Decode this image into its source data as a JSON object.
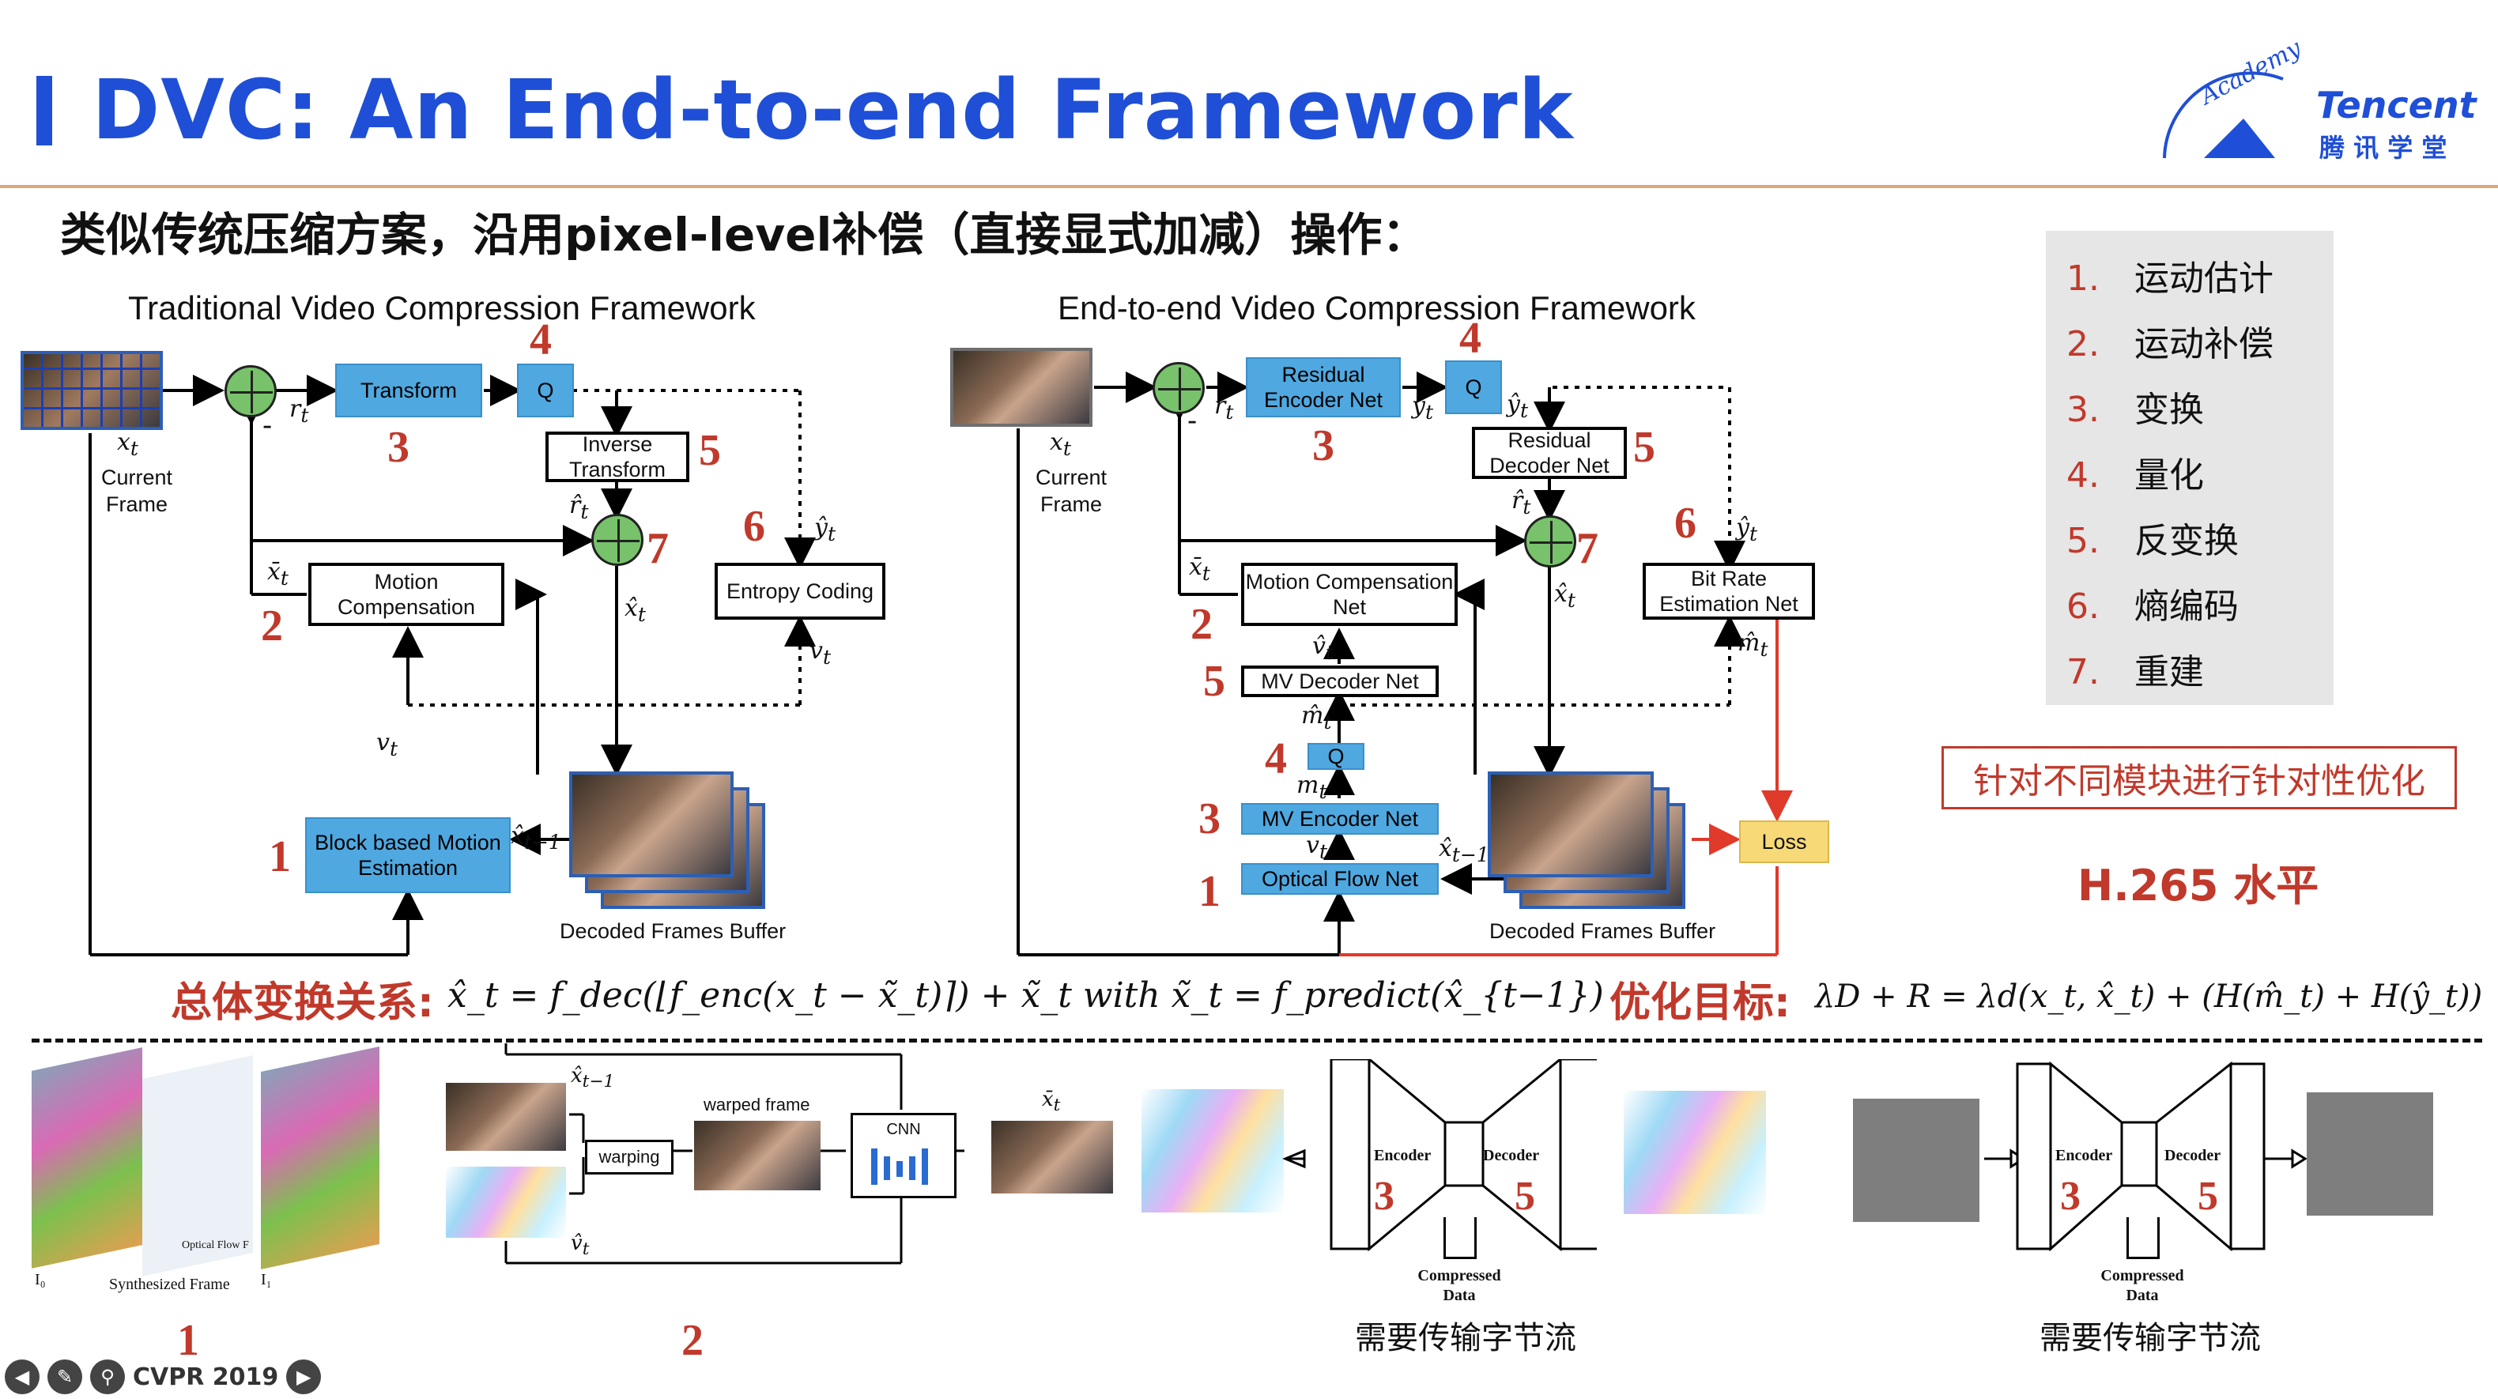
{
  "header": {
    "title": "DVC: An End-to-end Framework",
    "logo_text": "Tencent",
    "logo_sub": "腾 讯 学 堂",
    "logo_arc": "Academy"
  },
  "subtitle": "类似传统压缩方案，沿用pixel-level补偿（直接显式加减）操作：",
  "left_diagram": {
    "title": "Traditional Video Compression Framework",
    "transform": "Transform",
    "q": "Q",
    "inverse_transform": "Inverse Transform",
    "entropy_coding": "Entropy Coding",
    "motion_compensation": "Motion Compensation",
    "motion_estimation": "Block based Motion Estimation",
    "current_frame": "Current Frame",
    "buffer": "Decoded Frames Buffer",
    "x_t": "x",
    "r_t": "r",
    "r_hat_t": "r̂",
    "y_hat_t": "ŷ",
    "x_bar_t": "x̄",
    "x_hat_t": "x̂",
    "v_t": "v",
    "x_hat_t_1": "x̂",
    "nums": [
      "4",
      "3",
      "5",
      "6",
      "7",
      "2",
      "1"
    ]
  },
  "right_diagram": {
    "title": "End-to-end Video Compression Framework",
    "residual_encoder": "Residual Encoder Net",
    "q": "Q",
    "residual_decoder": "Residual Decoder Net",
    "bit_rate": "Bit Rate Estimation Net",
    "motion_compensation": "Motion Compensation Net",
    "mv_decoder": "MV Decoder Net",
    "q2": "Q",
    "mv_encoder": "MV Encoder Net",
    "optical_flow": "Optical Flow Net",
    "loss": "Loss",
    "current_frame": "Current Frame",
    "buffer": "Decoded Frames Buffer",
    "nums": [
      "4",
      "3",
      "5",
      "6",
      "7",
      "2",
      "5",
      "4",
      "3",
      "1"
    ]
  },
  "steps": {
    "items": [
      {
        "n": "1.",
        "label": "运动估计"
      },
      {
        "n": "2.",
        "label": "运动补偿"
      },
      {
        "n": "3.",
        "label": "变换"
      },
      {
        "n": "4.",
        "label": "量化"
      },
      {
        "n": "5.",
        "label": "反变换"
      },
      {
        "n": "6.",
        "label": "熵编码"
      },
      {
        "n": "7.",
        "label": "重建"
      }
    ]
  },
  "optimization_note": "针对不同模块进行针对性优化",
  "h265": "H.265 水平",
  "formula": {
    "label": "总体变换关系:",
    "expr": "x̂_t = f_dec(⌊f_enc(x_t − x̃_t)⌉) + x̃_t  with  x̃_t = f_predict(x̂_{t−1})",
    "goal_label": "优化目标:",
    "goal_expr": "λD + R = λd(x_t, x̂_t) + (H(m̂_t) + H(ŷ_t))"
  },
  "bottom": {
    "synth_caption": "Synthesized Frame",
    "i0": "I₀",
    "i1": "I₁",
    "optical_flow_caption": "Optical Flow F",
    "warping": "warping",
    "warped_frame": "warped frame",
    "cnn": "CNN",
    "encoder": "Encoder",
    "decoder": "Decoder",
    "compressed": "Compressed Data",
    "bytes_caption": "需要传输字节流",
    "num_1": "1",
    "num_2": "2",
    "num_3": "3",
    "num_5": "5"
  },
  "toolbar": {
    "cvpr_label": "CVPR 2019"
  },
  "colors": {
    "title_blue": "#1f4fd6",
    "accent_red": "#c0392b",
    "box_blue": "#4fa8e0",
    "loss_yellow": "#f7d978"
  }
}
